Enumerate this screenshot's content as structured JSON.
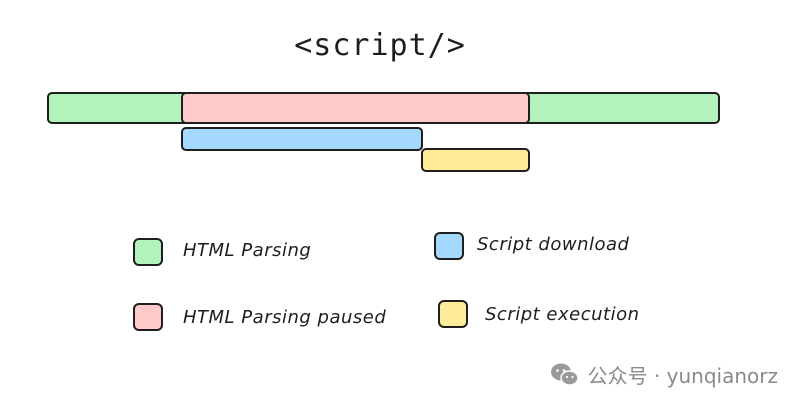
{
  "title": "<script/>",
  "colors": {
    "html_parsing": "#b2f2bb",
    "html_parsing_paused": "#ffc9c9",
    "script_download": "#a5d8ff",
    "script_execution": "#ffec99"
  },
  "legend": [
    {
      "label": "HTML Parsing",
      "color": "#b2f2bb"
    },
    {
      "label": "Script download",
      "color": "#a5d8ff"
    },
    {
      "label": "HTML Parsing paused",
      "color": "#ffc9c9"
    },
    {
      "label": "Script execution",
      "color": "#ffec99"
    }
  ],
  "watermark": {
    "text": "公众号 · yunqianorz",
    "icon": "wechat-icon"
  }
}
